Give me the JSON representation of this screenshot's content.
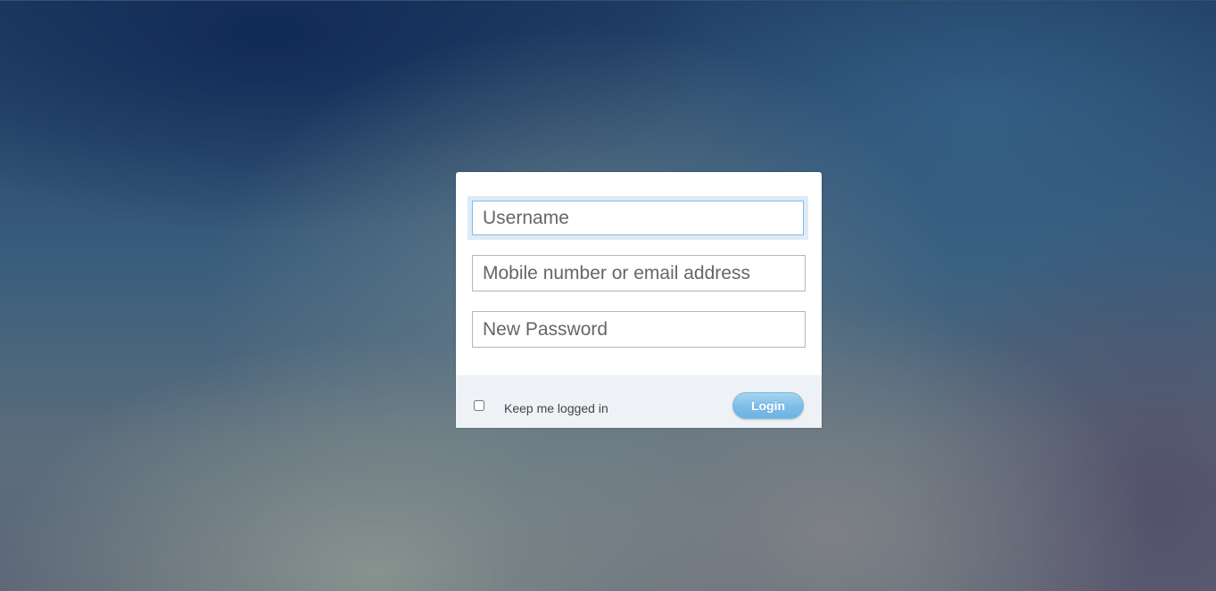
{
  "login_form": {
    "username": {
      "placeholder": "Username",
      "value": ""
    },
    "contact": {
      "placeholder": "Mobile number or email address",
      "value": ""
    },
    "password": {
      "placeholder": "New Password",
      "value": ""
    },
    "remember": {
      "label": "Keep me logged in",
      "checked": false
    },
    "submit_label": "Login"
  },
  "colors": {
    "accent": "#7cbde8",
    "focus_ring": "#dcebf7",
    "footer_background": "#eef2f6"
  }
}
